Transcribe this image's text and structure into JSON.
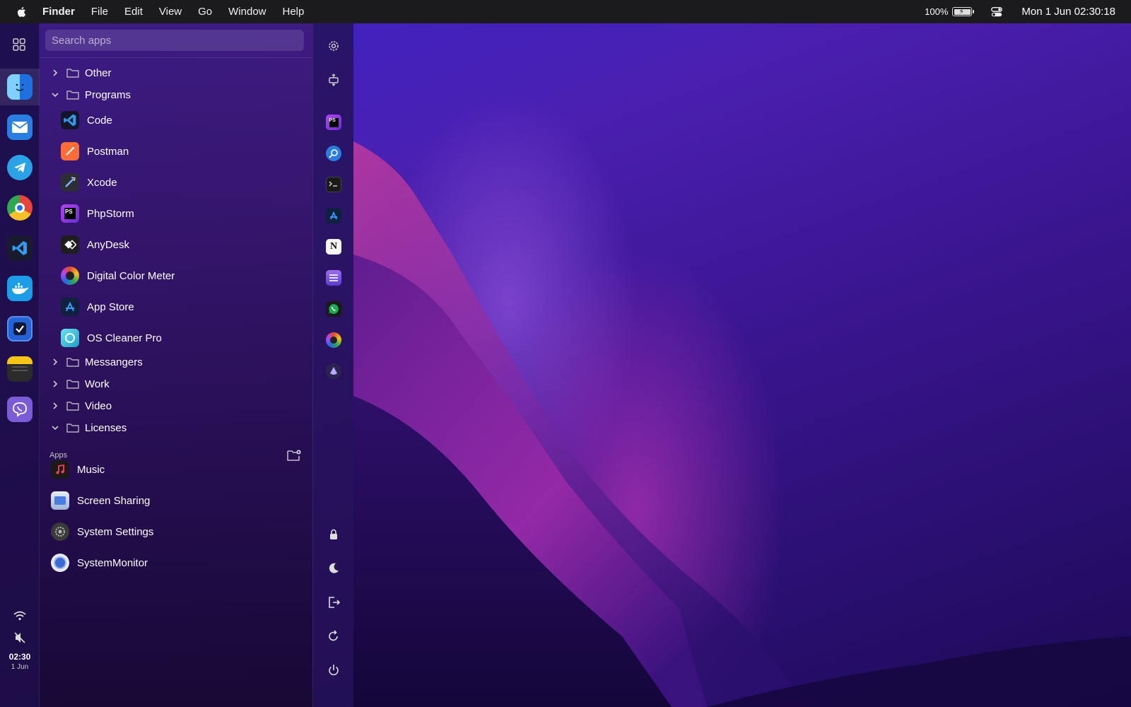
{
  "menubar": {
    "apple_icon": "apple-logo-icon",
    "app_name": "Finder",
    "menus": [
      "File",
      "Edit",
      "View",
      "Go",
      "Window",
      "Help"
    ],
    "battery_percent": "100%",
    "battery_icon": "battery-charging-icon",
    "control_center_icon": "control-center-icon",
    "datetime": "Mon 1 Jun  02:30:18"
  },
  "dock": {
    "apps": [
      {
        "name": "Finder",
        "icon": "finder-icon",
        "color": "#1e8cff"
      },
      {
        "name": "Mail",
        "icon": "mail-icon",
        "color": "#2a7de1"
      },
      {
        "name": "Telegram",
        "icon": "telegram-icon",
        "color": "#2aa3e6"
      },
      {
        "name": "Chrome",
        "icon": "chrome-icon",
        "color": "#e5453a"
      },
      {
        "name": "Visual Studio Code",
        "icon": "vscode-icon",
        "color": "#1f7ad6"
      },
      {
        "name": "Docker",
        "icon": "docker-icon",
        "color": "#1d9ce8"
      },
      {
        "name": "Tasks",
        "icon": "checkmark-app-icon",
        "color": "#2363d6"
      },
      {
        "name": "Notes",
        "icon": "notes-icon",
        "color": "#f5c518"
      },
      {
        "name": "Viber",
        "icon": "viber-icon",
        "color": "#7b5bd6"
      }
    ],
    "time": "02:30",
    "date": "1 Jun"
  },
  "launcher": {
    "search_placeholder": "Search apps",
    "folders_top": [
      {
        "label": "Other",
        "expanded": false
      },
      {
        "label": "Programs",
        "expanded": true
      }
    ],
    "programs": [
      {
        "label": "Code",
        "icon": "vscode-icon",
        "color": "#1f7ad6"
      },
      {
        "label": "Postman",
        "icon": "postman-icon",
        "color": "#ff6c37"
      },
      {
        "label": "Xcode",
        "icon": "xcode-icon",
        "color": "#2d2d35"
      },
      {
        "label": "PhpStorm",
        "icon": "phpstorm-icon",
        "color": "#7d3bd6"
      },
      {
        "label": "AnyDesk",
        "icon": "anydesk-icon",
        "color": "#333333"
      },
      {
        "label": "Digital Color Meter",
        "icon": "color-meter-icon",
        "color": "#e34b2a"
      },
      {
        "label": "App Store",
        "icon": "app-store-icon",
        "color": "#1c6fe0"
      },
      {
        "label": "OS Cleaner Pro",
        "icon": "cleaner-icon",
        "color": "#37c4d9"
      }
    ],
    "folders_bottom": [
      {
        "label": "Messangers",
        "expanded": false
      },
      {
        "label": "Work",
        "expanded": false
      },
      {
        "label": "Video",
        "expanded": false
      },
      {
        "label": "Licenses",
        "expanded": true
      }
    ],
    "apps_section_label": "Apps",
    "apps": [
      {
        "label": "Music",
        "icon": "music-icon",
        "color": "#222222"
      },
      {
        "label": "Screen Sharing",
        "icon": "screen-sharing-icon",
        "color": "#4a7de0"
      },
      {
        "label": "System Settings",
        "icon": "system-settings-icon",
        "color": "#555555"
      },
      {
        "label": "SystemMonitor",
        "icon": "system-monitor-icon",
        "color": "#d9d9d9"
      }
    ]
  },
  "controls": {
    "pinned": [
      {
        "name": "PhpStorm",
        "icon": "phpstorm-icon",
        "color": "#7d3bd6"
      },
      {
        "name": "Proxyman",
        "icon": "magnifier-app-icon",
        "color": "#2a7de1"
      },
      {
        "name": "Terminal",
        "icon": "terminal-icon",
        "color": "#222222"
      },
      {
        "name": "App Store",
        "icon": "app-store-icon",
        "color": "#1c6fe0"
      },
      {
        "name": "Notion",
        "icon": "notion-icon",
        "color": "#f5f5f5"
      },
      {
        "name": "Lists",
        "icon": "lists-app-icon",
        "color": "#7e55e0"
      },
      {
        "name": "WhatsApp",
        "icon": "whatsapp-icon",
        "color": "#1fa855"
      },
      {
        "name": "Digital Color Meter",
        "icon": "color-meter-icon",
        "color": "#e34b2a"
      },
      {
        "name": "Alfred",
        "icon": "alfred-icon",
        "color": "#4a3a8a"
      }
    ]
  }
}
